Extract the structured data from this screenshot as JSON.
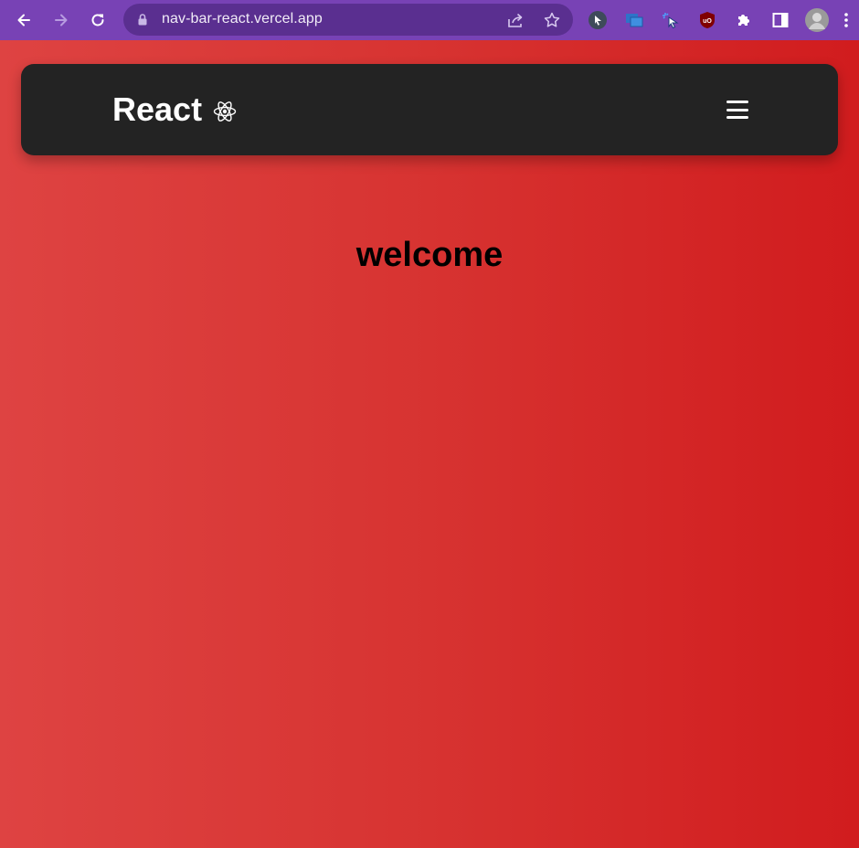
{
  "browser": {
    "url": "nav-bar-react.vercel.app",
    "back_icon": "arrow-left-icon",
    "forward_icon": "arrow-right-icon",
    "reload_icon": "reload-icon",
    "chrome_color": "#7842b5"
  },
  "navbar": {
    "brand_label": "React",
    "brand_icon": "react-atom-icon",
    "menu_icon": "hamburger-menu-icon",
    "background": "#232323"
  },
  "main": {
    "heading": "welcome"
  },
  "colors": {
    "gradient_left": "#de4342",
    "gradient_right": "#d11c1e"
  }
}
